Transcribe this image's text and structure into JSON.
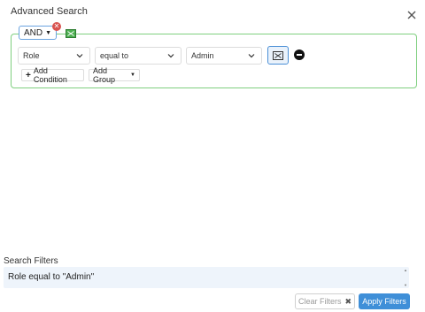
{
  "dialog": {
    "title": "Advanced Search"
  },
  "group": {
    "conjunction": "AND"
  },
  "rule": {
    "field": "Role",
    "operator": "equal to",
    "value": "Admin"
  },
  "actions": {
    "add_condition": "Add Condition",
    "add_group": "Add Group"
  },
  "filters": {
    "label": "Search Filters",
    "expression": "Role equal to \"Admin\""
  },
  "footer": {
    "clear_label": "Clear Filters",
    "apply_label": "Apply Filters"
  },
  "icons": {
    "close": "close-icon",
    "remove_group": "remove-group-icon",
    "group": "group-icon",
    "chevron": "chevron-down-icon",
    "picker": "value-picker-icon",
    "remove_rule": "remove-rule-icon",
    "plus": "plus-icon",
    "clear_x": "clear-icon"
  },
  "colors": {
    "group_border": "#7fcf7f",
    "accent": "#3f8fd8",
    "danger": "#d9534f",
    "filters_bg": "#eef4fb"
  }
}
